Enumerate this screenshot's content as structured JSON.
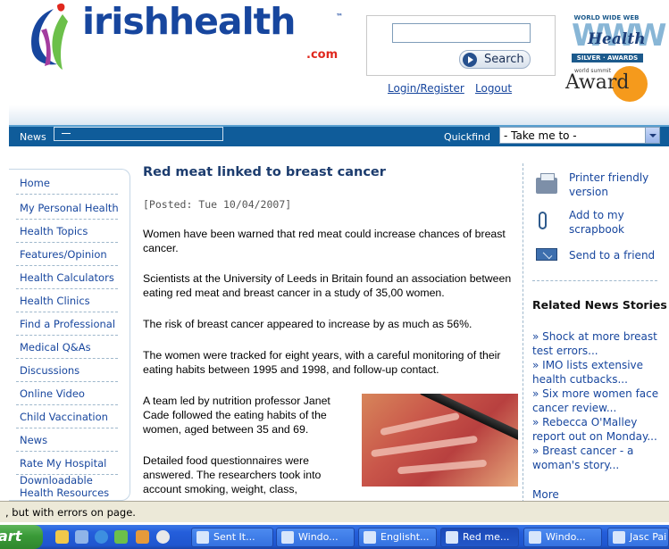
{
  "header": {
    "logo": {
      "irish": "irish",
      "health": "health",
      "tm": "™",
      "com": ".com"
    },
    "search_button": "Search",
    "login_register": "Login/Register",
    "logout": "Logout",
    "www_award": {
      "top": "WORLD WIDE WEB",
      "letters": "WWW",
      "health": "Health",
      "bottom": "SILVER · AWARDS"
    },
    "award_badge": {
      "small": "world summit",
      "word": "Award"
    }
  },
  "nav": {
    "news_label": "News",
    "quickfind_label": "Quickfind",
    "quickfind_value": "- Take me to -"
  },
  "sidebar": {
    "items": [
      {
        "label": "Home"
      },
      {
        "label": "My Personal Health"
      },
      {
        "label": "Health Topics"
      },
      {
        "label": "Features/Opinion"
      },
      {
        "label": "Health Calculators"
      },
      {
        "label": "Health Clinics"
      },
      {
        "label": "Find a Professional"
      },
      {
        "label": "Medical Q&As"
      },
      {
        "label": "Discussions"
      },
      {
        "label": "Online Video"
      },
      {
        "label": "Child Vaccination"
      },
      {
        "label": "News"
      },
      {
        "label": "Rate My Hospital"
      },
      {
        "label": "Downloadable Health Resources"
      }
    ]
  },
  "article": {
    "title": "Red meat linked to breast cancer",
    "posted": "[Posted: Tue 10/04/2007]",
    "paragraphs": [
      "Women have been warned that red meat could increase chances of breast cancer.",
      "Scientists at the University of Leeds in Britain found an association between eating red meat and breast cancer in a study of 35,00 women.",
      "The risk of breast cancer appeared to increase by as much as 56%.",
      "The women were tracked for eight years, with a careful monitoring of their eating habits between 1995 and 1998, and follow-up contact.",
      "A team led by nutrition professor Janet Cade followed the eating habits of the women, aged between 35 and 69.",
      "Detailed food questionnaires were answered. The researchers took into account smoking, weight, class,"
    ]
  },
  "tools": {
    "printer": "Printer friendly version",
    "scrapbook": "Add to my scrapbook",
    "send": "Send to a friend"
  },
  "related": {
    "heading": "Related News Stories",
    "items": [
      "» Shock at more breast test errors...",
      "» IMO lists extensive health cutbacks...",
      "» Six more women face cancer review...",
      "» Rebecca O'Malley report out on Monday...",
      "» Breast cancer - a woman's story..."
    ],
    "more": "More"
  },
  "status_bar": {
    "text": ", but with errors on page."
  },
  "taskbar": {
    "start": "art",
    "buttons": [
      {
        "label": "Sent It..."
      },
      {
        "label": "Windo..."
      },
      {
        "label": "Englisht..."
      },
      {
        "label": "Red me..."
      },
      {
        "label": "Windo..."
      },
      {
        "label": "Jasc Pai"
      }
    ]
  }
}
